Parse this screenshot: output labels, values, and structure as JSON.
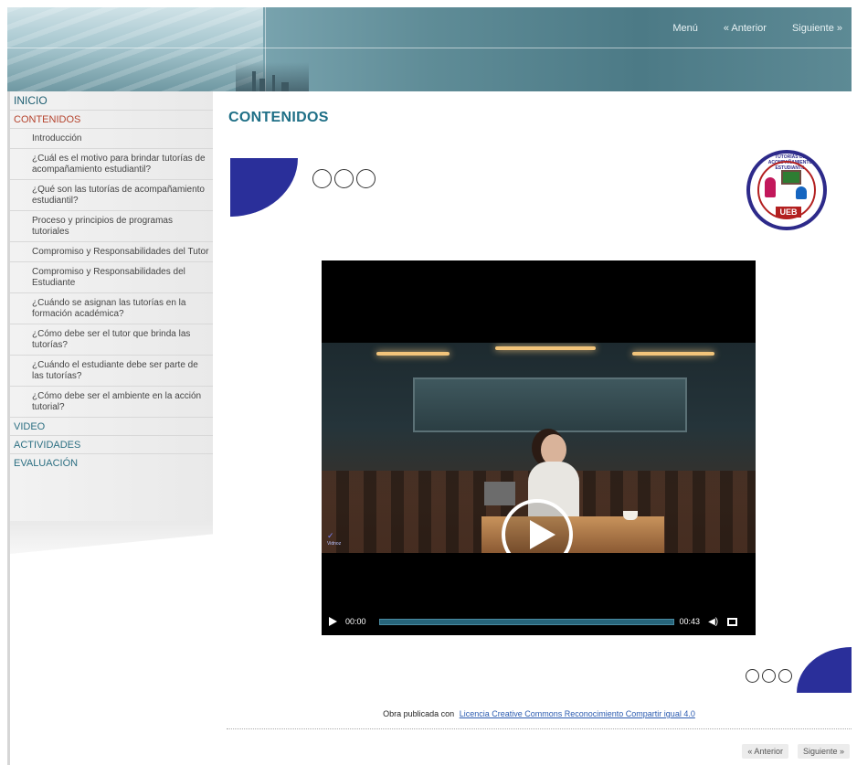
{
  "top_nav": {
    "menu": "Menú",
    "previous": "« Anterior",
    "next": "Siguiente »"
  },
  "sidebar": {
    "home": "INICIO",
    "contents": "CONTENIDOS",
    "sub_items": [
      "Introducción",
      "¿Cuál es el motivo para brindar tutorías de acompañamiento estudiantil?",
      "¿Qué son las tutorías de acompañamiento estudiantil?",
      "Proceso y principios de programas tutoriales",
      "Compromiso y Responsabilidades del Tutor",
      "Compromiso y Responsabilidades del Estudiante",
      "¿Cuándo se asignan las tutorías en la formación académica?",
      "¿Cómo debe ser el tutor que brinda las tutorías?",
      "¿Cuándo el estudiante debe ser parte de las tutorías?",
      "¿Cómo debe ser el ambiente en la acción tutorial?"
    ],
    "video": "VIDEO",
    "activities": "ACTIVIDADES",
    "evaluation": "EVALUACIÓN"
  },
  "main": {
    "title": "CONTENIDOS",
    "logo_text": "TUTORÍAS DE ACOMPAÑAMIENTO ESTUDIANTIL",
    "logo_badge": "UEB"
  },
  "video": {
    "current_time": "00:00",
    "duration": "00:43",
    "watermark": "Vidnoz",
    "progress": 0
  },
  "footer": {
    "license_prefix": "Obra publicada con",
    "license_link": "Licencia Creative Commons Reconocimiento Compartir igual 4.0",
    "previous": "« Anterior",
    "next": "Siguiente »"
  },
  "colors": {
    "accent_blue": "#2a2f9a",
    "title_teal": "#1e6f86",
    "active_nav": "#b5432d"
  }
}
